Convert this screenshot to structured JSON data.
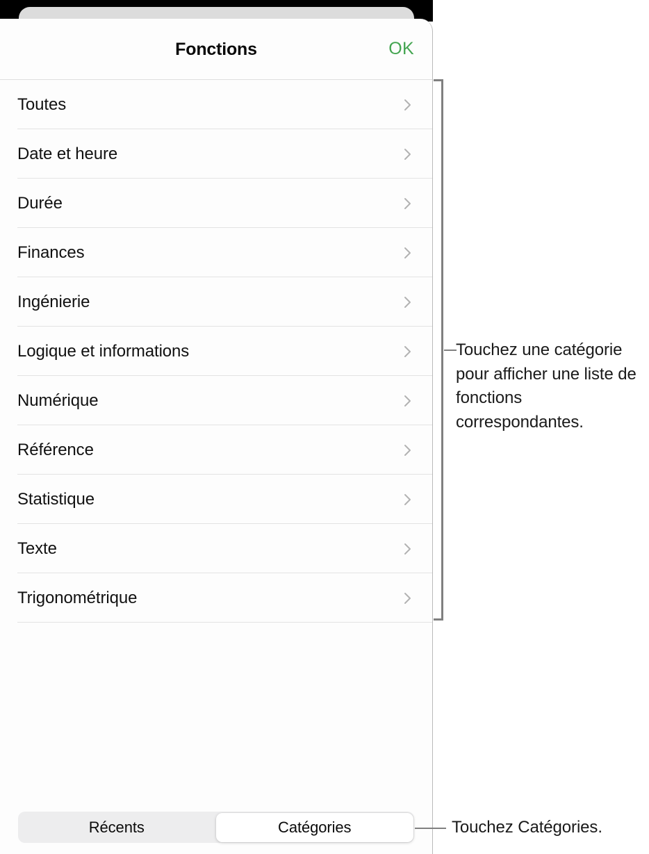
{
  "header": {
    "title": "Fonctions",
    "ok_label": "OK",
    "ok_color": "#44a551"
  },
  "categories": [
    {
      "label": "Toutes",
      "icon": "chevron-right-icon"
    },
    {
      "label": "Date et heure",
      "icon": "chevron-right-icon"
    },
    {
      "label": "Durée",
      "icon": "chevron-right-icon"
    },
    {
      "label": "Finances",
      "icon": "chevron-right-icon"
    },
    {
      "label": "Ingénierie",
      "icon": "chevron-right-icon"
    },
    {
      "label": "Logique et informations",
      "icon": "chevron-right-icon"
    },
    {
      "label": "Numérique",
      "icon": "chevron-right-icon"
    },
    {
      "label": "Référence",
      "icon": "chevron-right-icon"
    },
    {
      "label": "Statistique",
      "icon": "chevron-right-icon"
    },
    {
      "label": "Texte",
      "icon": "chevron-right-icon"
    },
    {
      "label": "Trigonométrique",
      "icon": "chevron-right-icon"
    }
  ],
  "tabbar": {
    "tabs": [
      {
        "label": "Récents",
        "selected": false
      },
      {
        "label": "Catégories",
        "selected": true
      }
    ],
    "selected_bg": "#ffffff",
    "track_bg": "#ededee"
  },
  "annotations": {
    "list_callout": "Touchez une catégorie pour afficher une liste de fonctions correspondantes.",
    "tab_callout": "Touchez Catégories.",
    "line_color": "#808080"
  }
}
